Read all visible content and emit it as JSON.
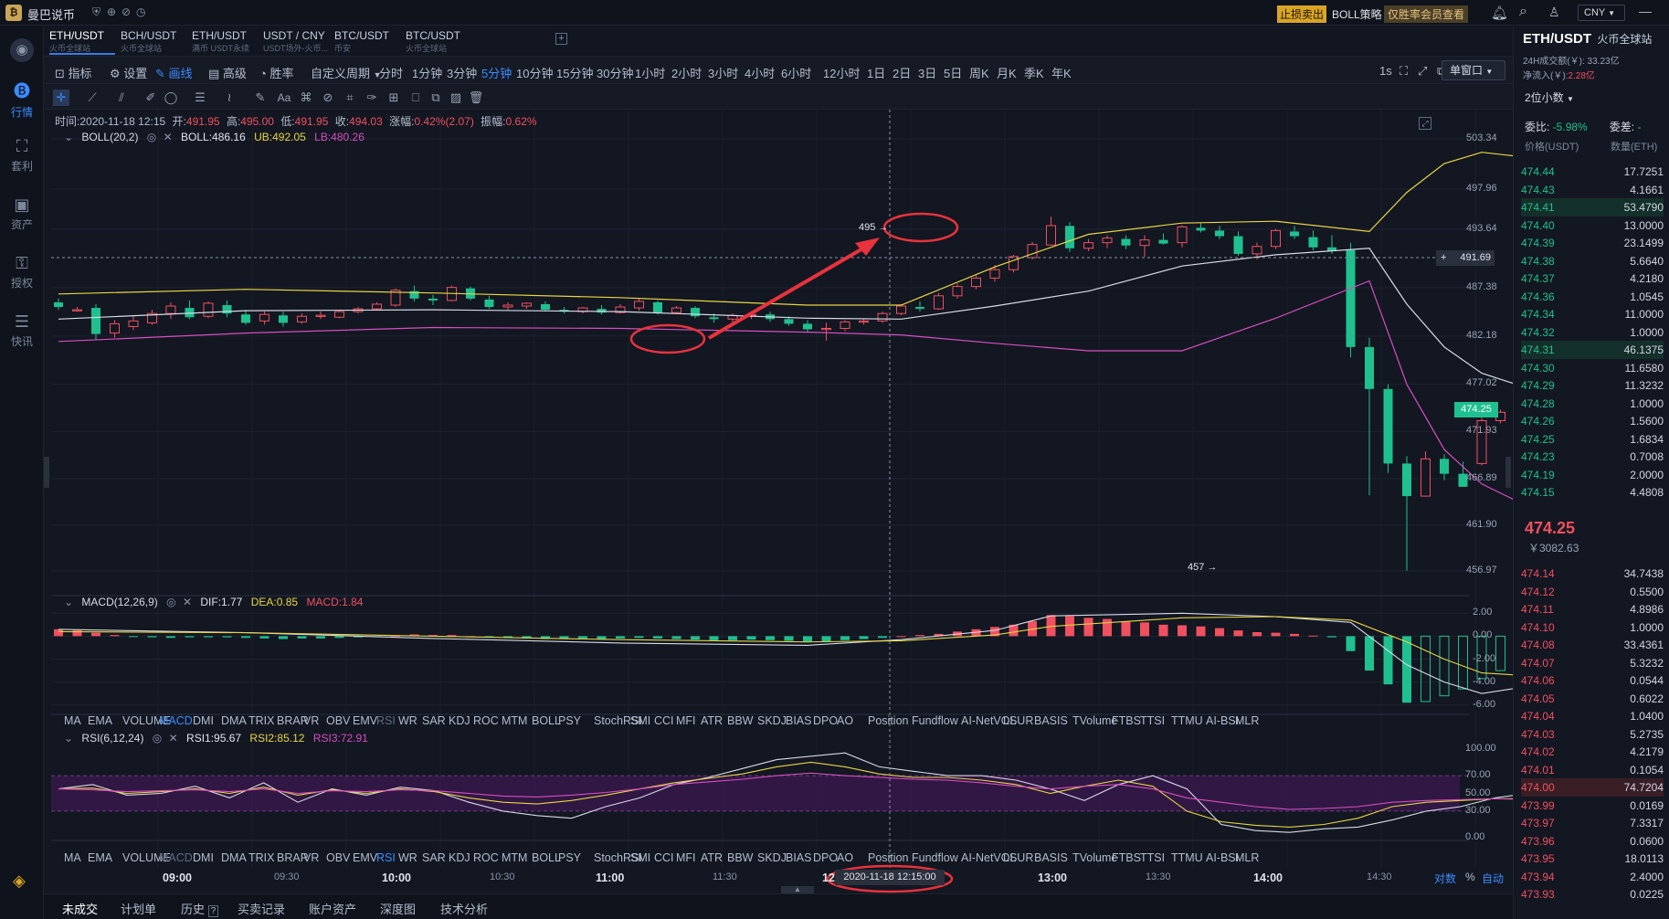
{
  "app": {
    "name": "曼巴说币",
    "title_badges": [
      "止损卖出",
      "BOLL策略",
      "仅胜率会员查看"
    ],
    "currency": "CNY"
  },
  "tabs": [
    {
      "pair": "ETH/USDT",
      "sub": "火币全球站"
    },
    {
      "pair": "BCH/USDT",
      "sub": "火币全球站"
    },
    {
      "pair": "ETH/USDT",
      "sub": "满币 USDT永续"
    },
    {
      "pair": "USDT / CNY",
      "sub": "USDT场外-火币..."
    },
    {
      "pair": "BTC/USDT",
      "sub": "币安"
    },
    {
      "pair": "BTC/USDT",
      "sub": "火币全球站"
    }
  ],
  "toolbar": {
    "left": [
      "指标",
      "设置",
      "画线",
      "高级",
      "胜率"
    ],
    "period_label": "自定义周期",
    "periods": [
      "分时",
      "1分钟",
      "3分钟",
      "5分钟",
      "10分钟",
      "15分钟",
      "30分钟",
      "1小时",
      "2小时",
      "3小时",
      "4小时",
      "6小时",
      "12小时",
      "1日",
      "2日",
      "3日",
      "5日",
      "周K",
      "月K",
      "季K",
      "年K"
    ],
    "active_period": "5分钟",
    "right_interval": "1s",
    "window": "单窗口"
  },
  "left_nav": [
    "行情",
    "套利",
    "资产",
    "授权",
    "快讯"
  ],
  "ohlc": {
    "time_label": "时间:",
    "time": "2020-11-18 12:15",
    "open_label": "开:",
    "open": "491.95",
    "high_label": "高:",
    "high": "495.00",
    "low_label": "低:",
    "low": "491.95",
    "close_label": "收:",
    "close": "494.03",
    "chg_label": "涨幅:",
    "chg": "0.42%(2.07)",
    "amp_label": "振幅:",
    "amp": "0.62%"
  },
  "boll": {
    "name": "BOLL(20,2)",
    "mid": "BOLL:486.16",
    "ub": "UB:492.05",
    "lb": "LB:480.26"
  },
  "macd": {
    "name": "MACD(12,26,9)",
    "dif": "DIF:1.77",
    "dea": "DEA:0.85",
    "macd": "MACD:1.84"
  },
  "rsi": {
    "name": "RSI(6,12,24)",
    "r1": "RSI1:95.67",
    "r2": "RSI2:85.12",
    "r3": "RSI3:72.91"
  },
  "indicators": [
    "MA",
    "EMA",
    "VOLUME",
    "MACD",
    "DMI",
    "DMA",
    "TRIX",
    "BRAR",
    "VR",
    "OBV",
    "EMV",
    "RSI",
    "WR",
    "SAR",
    "KDJ",
    "ROC",
    "MTM",
    "BOLL",
    "PSY",
    "StochRSI",
    "SMI",
    "CCI",
    "MFI",
    "ATR",
    "BBW",
    "SKDJ",
    "BIAS",
    "DPO",
    "AO",
    "Position",
    "Fundflow",
    "AI-NetVOL",
    "LSUR",
    "BASIS",
    "TVolume",
    "FTBS",
    "TTSI",
    "TTMU",
    "AI-BSI",
    "MLR"
  ],
  "main_axis": [
    "503.34",
    "497.96",
    "493.64",
    "487.38",
    "482.18",
    "477.02",
    "471.93",
    "466.89",
    "461.90",
    "456.97"
  ],
  "crosshair_price": "491.69",
  "last_price_tag": "474.25",
  "annotations": {
    "high": "495",
    "low": "457"
  },
  "macd_axis": [
    "2.00",
    "0.00",
    "-2.00",
    "-4.00",
    "-6.00"
  ],
  "rsi_axis": [
    "100.00",
    "70.00",
    "50.00",
    "30.00",
    "0.00"
  ],
  "time_axis": [
    "09:00",
    "09:30",
    "10:00",
    "10:30",
    "11:00",
    "11:30",
    "12:00",
    "13:00",
    "13:30",
    "14:00",
    "14:30"
  ],
  "crosshair_time": "2020-11-18 12:15:00",
  "axis_controls": [
    "对数",
    "%",
    "自动"
  ],
  "bottom_tabs": [
    "未成交",
    "计划单",
    "历史",
    "买卖记录",
    "账户资产",
    "深度图",
    "技术分析"
  ],
  "right_panel": {
    "pair": "ETH/USDT",
    "exchange": "火币全球站",
    "vol24": "24H成交额(￥): 33.23亿",
    "inflow_label": "净流入(￥):",
    "inflow": "2.28亿",
    "decimals": "2位小数",
    "ratio_label": "委比:",
    "ratio": "-5.98%",
    "diff_label": "委差:",
    "diff": "-",
    "col_price": "价格(USDT)",
    "col_qty": "数量(ETH)",
    "asks": [
      [
        "474.44",
        "17.7251"
      ],
      [
        "474.43",
        "4.1661"
      ],
      [
        "474.41",
        "53.4790"
      ],
      [
        "474.40",
        "13.0000"
      ],
      [
        "474.39",
        "23.1499"
      ],
      [
        "474.38",
        "5.6640"
      ],
      [
        "474.37",
        "4.2180"
      ],
      [
        "474.36",
        "1.0545"
      ],
      [
        "474.34",
        "11.0000"
      ],
      [
        "474.32",
        "1.0000"
      ],
      [
        "474.31",
        "46.1375"
      ],
      [
        "474.30",
        "11.6580"
      ],
      [
        "474.29",
        "11.3232"
      ],
      [
        "474.28",
        "1.0000"
      ],
      [
        "474.26",
        "1.5600"
      ],
      [
        "474.25",
        "1.6834"
      ],
      [
        "474.23",
        "0.7008"
      ],
      [
        "474.19",
        "2.0000"
      ],
      [
        "474.15",
        "4.4808"
      ]
    ],
    "last": "474.25",
    "last_cny": "￥3082.63",
    "bids": [
      [
        "474.14",
        "34.7438"
      ],
      [
        "474.12",
        "0.5500"
      ],
      [
        "474.11",
        "4.8986"
      ],
      [
        "474.10",
        "1.0000"
      ],
      [
        "474.08",
        "33.4361"
      ],
      [
        "474.07",
        "5.3232"
      ],
      [
        "474.06",
        "0.0544"
      ],
      [
        "474.05",
        "0.6022"
      ],
      [
        "474.04",
        "1.0400"
      ],
      [
        "474.03",
        "5.2735"
      ],
      [
        "474.02",
        "4.2179"
      ],
      [
        "474.01",
        "0.1054"
      ],
      [
        "474.00",
        "74.7204"
      ],
      [
        "473.99",
        "0.0169"
      ],
      [
        "473.97",
        "7.3317"
      ],
      [
        "473.96",
        "0.0600"
      ],
      [
        "473.95",
        "18.0113"
      ],
      [
        "473.94",
        "2.4000"
      ],
      [
        "473.93",
        "0.0225"
      ]
    ]
  },
  "chart_data": {
    "type": "candlestick",
    "interval": "5分钟",
    "x_ticks": [
      "09:00",
      "09:30",
      "10:00",
      "10:30",
      "11:00",
      "11:30",
      "12:00",
      "13:00",
      "13:30",
      "14:00",
      "14:30"
    ],
    "ylim": [
      455.5,
      505.5
    ],
    "y_ticks": [
      503.34,
      497.96,
      493.64,
      487.38,
      482.18,
      477.02,
      471.93,
      466.89,
      461.9,
      456.97
    ],
    "candles": [
      [
        485.8,
        486.2,
        485.0,
        485.3
      ],
      [
        485.0,
        485.3,
        484.8,
        485.0
      ],
      [
        485.2,
        485.6,
        481.8,
        482.4
      ],
      [
        482.5,
        483.9,
        482.0,
        483.5
      ],
      [
        483.2,
        484.4,
        482.8,
        483.8
      ],
      [
        483.6,
        485.0,
        483.4,
        484.6
      ],
      [
        484.6,
        485.8,
        484.0,
        485.4
      ],
      [
        485.2,
        486.0,
        484.0,
        484.2
      ],
      [
        484.3,
        485.9,
        484.1,
        485.7
      ],
      [
        485.5,
        486.0,
        484.2,
        484.6
      ],
      [
        484.5,
        485.0,
        483.4,
        483.6
      ],
      [
        483.8,
        484.8,
        483.4,
        484.5
      ],
      [
        484.4,
        484.8,
        483.2,
        483.6
      ],
      [
        483.7,
        484.6,
        483.5,
        484.3
      ],
      [
        484.3,
        484.8,
        484.0,
        484.4
      ],
      [
        484.2,
        484.9,
        484.1,
        484.8
      ],
      [
        484.8,
        485.3,
        484.6,
        485.1
      ],
      [
        485.1,
        485.8,
        485.0,
        485.6
      ],
      [
        485.5,
        487.3,
        485.3,
        487.1
      ],
      [
        487.0,
        487.6,
        485.9,
        486.2
      ],
      [
        486.2,
        486.6,
        485.5,
        486.0
      ],
      [
        486.0,
        487.6,
        485.9,
        487.4
      ],
      [
        487.3,
        487.5,
        486.0,
        486.2
      ],
      [
        486.1,
        486.5,
        485.1,
        485.3
      ],
      [
        485.3,
        485.8,
        485.0,
        485.5
      ],
      [
        485.4,
        485.8,
        485.1,
        485.7
      ],
      [
        485.6,
        485.9,
        484.8,
        485.0
      ],
      [
        485.0,
        485.3,
        484.6,
        484.8
      ],
      [
        484.8,
        485.3,
        484.6,
        485.2
      ],
      [
        485.1,
        485.5,
        484.5,
        484.7
      ],
      [
        484.7,
        485.6,
        484.6,
        485.3
      ],
      [
        485.2,
        486.2,
        484.9,
        485.9
      ],
      [
        485.8,
        486.0,
        484.5,
        484.7
      ],
      [
        484.7,
        485.4,
        484.6,
        485.2
      ],
      [
        485.2,
        485.4,
        484.1,
        484.3
      ],
      [
        484.2,
        484.6,
        483.6,
        484.0
      ],
      [
        484.0,
        484.6,
        483.5,
        484.4
      ],
      [
        484.4,
        484.7,
        484.0,
        484.5
      ],
      [
        484.5,
        484.8,
        483.7,
        484.0
      ],
      [
        484.0,
        484.3,
        483.3,
        483.5
      ],
      [
        483.5,
        483.9,
        482.6,
        482.9
      ],
      [
        482.9,
        483.6,
        481.7,
        483.0
      ],
      [
        483.0,
        483.9,
        482.7,
        483.7
      ],
      [
        483.7,
        484.0,
        483.4,
        483.8
      ],
      [
        483.8,
        484.8,
        483.6,
        484.6
      ],
      [
        484.6,
        485.6,
        484.4,
        485.4
      ],
      [
        485.3,
        485.9,
        484.8,
        485.1
      ],
      [
        485.1,
        486.8,
        485.0,
        486.5
      ],
      [
        486.5,
        487.8,
        486.2,
        487.5
      ],
      [
        487.5,
        488.7,
        487.2,
        488.4
      ],
      [
        488.4,
        489.8,
        488.0,
        489.3
      ],
      [
        489.3,
        490.9,
        489.0,
        490.7
      ],
      [
        490.6,
        492.3,
        490.4,
        492.0
      ],
      [
        491.95,
        495.0,
        491.95,
        494.03
      ],
      [
        494.0,
        494.4,
        491.2,
        491.6
      ],
      [
        491.6,
        492.6,
        491.3,
        492.2
      ],
      [
        492.2,
        493.0,
        491.6,
        492.7
      ],
      [
        492.6,
        493.0,
        491.5,
        491.9
      ],
      [
        491.9,
        493.0,
        490.7,
        492.5
      ],
      [
        492.5,
        493.2,
        492.0,
        492.1
      ],
      [
        492.2,
        494.1,
        491.7,
        493.9
      ],
      [
        493.8,
        494.3,
        493.3,
        493.5
      ],
      [
        493.5,
        494.0,
        492.6,
        492.9
      ],
      [
        492.9,
        493.4,
        490.8,
        491.0
      ],
      [
        491.0,
        492.2,
        490.4,
        491.8
      ],
      [
        491.8,
        493.7,
        491.5,
        493.5
      ],
      [
        493.4,
        494.0,
        492.6,
        492.9
      ],
      [
        492.8,
        493.5,
        491.4,
        491.7
      ],
      [
        491.7,
        493.0,
        491.0,
        491.3
      ],
      [
        491.4,
        492.2,
        479.9,
        481.0
      ],
      [
        481.0,
        482.0,
        465.1,
        476.5
      ],
      [
        476.5,
        477.0,
        467.5,
        468.5
      ],
      [
        468.5,
        469.3,
        457.0,
        465.0
      ],
      [
        465.0,
        469.8,
        466.0,
        469.0
      ],
      [
        469.0,
        469.5,
        466.7,
        467.4
      ],
      [
        467.4,
        468.7,
        466.2,
        466.0
      ],
      [
        468.5,
        473.4,
        468.3,
        473.1
      ],
      [
        473.1,
        474.3,
        472.8,
        474.0
      ],
      [
        474.0,
        474.6,
        473.2,
        474.3
      ],
      [
        474.3,
        475.4,
        473.6,
        474.7
      ],
      [
        474.6,
        475.0,
        473.2,
        473.5
      ],
      [
        473.5,
        474.9,
        473.2,
        474.6
      ],
      [
        474.7,
        475.2,
        473.6,
        474.1
      ],
      [
        474.1,
        475.3,
        473.6,
        475.0
      ],
      [
        475.0,
        475.2,
        473.9,
        474.25
      ]
    ],
    "series": [
      {
        "name": "BOLL",
        "x": [
          0,
          10,
          20,
          30,
          40,
          45,
          50,
          55,
          60,
          65,
          70,
          72,
          74,
          76,
          80,
          85
        ],
        "y": [
          484.0,
          484.9,
          485.0,
          484.8,
          484.1,
          484.0,
          485.4,
          487.0,
          489.7,
          490.9,
          491.6,
          485.6,
          481.0,
          478.2,
          475.6,
          473.2
        ]
      },
      {
        "name": "UB",
        "x": [
          0,
          10,
          20,
          30,
          40,
          45,
          50,
          55,
          60,
          65,
          70,
          72,
          74,
          76,
          80,
          85
        ],
        "y": [
          486.7,
          487.2,
          486.8,
          486.3,
          485.5,
          485.5,
          489.6,
          493.1,
          494.3,
          494.5,
          493.4,
          497.6,
          500.7,
          501.9,
          501.0,
          495.2
        ]
      },
      {
        "name": "LB",
        "x": [
          0,
          10,
          20,
          30,
          40,
          45,
          50,
          55,
          60,
          65,
          70,
          72,
          74,
          76,
          80,
          85
        ],
        "y": [
          481.6,
          482.5,
          483.1,
          483.0,
          482.6,
          482.3,
          481.4,
          480.6,
          480.6,
          484.1,
          488.1,
          477.0,
          470.0,
          466.3,
          462.4,
          461.8
        ]
      }
    ],
    "macd_ylim": [
      -6.5,
      2.5
    ],
    "macd_hist": [
      0.6,
      0.5,
      0.3,
      0.1,
      -0.05,
      -0.1,
      -0.15,
      -0.1,
      -0.1,
      -0.1,
      -0.15,
      -0.2,
      -0.25,
      -0.2,
      -0.2,
      -0.15,
      -0.1,
      -0.05,
      0.05,
      0.15,
      0.1,
      0.1,
      0.0,
      -0.1,
      -0.15,
      -0.2,
      -0.25,
      -0.25,
      -0.2,
      -0.25,
      -0.2,
      -0.15,
      -0.2,
      -0.25,
      -0.3,
      -0.35,
      -0.35,
      -0.3,
      -0.35,
      -0.4,
      -0.45,
      -0.45,
      -0.35,
      -0.25,
      -0.15,
      0.0,
      0.1,
      0.2,
      0.4,
      0.6,
      0.8,
      1.0,
      1.3,
      1.84,
      1.75,
      1.6,
      1.5,
      1.3,
      1.2,
      1.0,
      0.95,
      0.85,
      0.7,
      0.5,
      0.35,
      0.3,
      0.2,
      0.05,
      -0.1,
      -1.3,
      -3.0,
      -4.2,
      -5.8,
      -5.7,
      -5.2,
      -4.6,
      -3.7,
      -3.0,
      -2.4,
      -1.9,
      -1.3,
      -0.9,
      -0.5,
      -0.2,
      0.2,
      0.5,
      0.6
    ],
    "macd_dif": [
      0.6,
      0.3,
      -0.2,
      -0.6,
      -0.8,
      -0.3,
      0.5,
      1.77,
      2.0,
      1.7,
      1.2,
      -2.5,
      -4.0,
      -5.0,
      -4.0,
      -3.0
    ],
    "macd_dea": [
      0.4,
      0.3,
      0.0,
      -0.3,
      -0.5,
      -0.4,
      0.1,
      0.85,
      1.6,
      1.7,
      1.4,
      -0.5,
      -2.0,
      -3.2,
      -3.6,
      -3.3
    ],
    "rsi_ylim": [
      0,
      100
    ],
    "rsi1": [
      55,
      60,
      48,
      50,
      58,
      45,
      62,
      40,
      55,
      48,
      57,
      53,
      40,
      30,
      25,
      22,
      35,
      45,
      60,
      68,
      78,
      88,
      92,
      95.67,
      80,
      75,
      70,
      70,
      65,
      55,
      42,
      60,
      70,
      55,
      15,
      8,
      6,
      10,
      12,
      20,
      30,
      35,
      45,
      50,
      45,
      40,
      38
    ],
    "rsi2": [
      55,
      56,
      50,
      52,
      55,
      50,
      57,
      48,
      54,
      50,
      55,
      52,
      45,
      40,
      38,
      42,
      48,
      55,
      62,
      67,
      72,
      80,
      85.12,
      80,
      72,
      68,
      68,
      65,
      60,
      50,
      58,
      65,
      58,
      30,
      18,
      14,
      12,
      15,
      22,
      35,
      40,
      42,
      44,
      44,
      42,
      40,
      40
    ],
    "rsi3": [
      55,
      54,
      52,
      53,
      54,
      52,
      55,
      50,
      53,
      52,
      54,
      53,
      50,
      47,
      46,
      48,
      51,
      55,
      60,
      63,
      66,
      70,
      72.91,
      70,
      68,
      66,
      65,
      62,
      58,
      55,
      58,
      60,
      55,
      45,
      40,
      35,
      32,
      33,
      35,
      40,
      42,
      43,
      44,
      43,
      42,
      41,
      40
    ]
  }
}
